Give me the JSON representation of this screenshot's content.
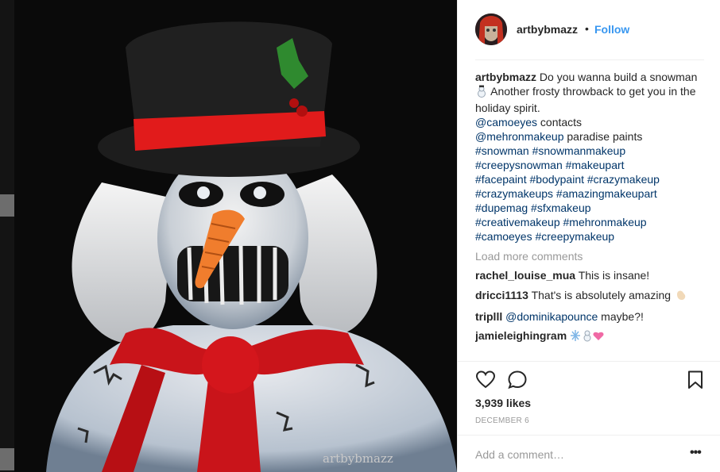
{
  "post": {
    "watermark": "artbybmazz"
  },
  "header": {
    "username": "artbybmazz",
    "separator": "•",
    "follow_label": "Follow"
  },
  "caption": {
    "username": "artbybmazz",
    "text": "Do you wanna build a snowman",
    "text2": "Another frosty throwback to get you in the holiday spirit.",
    "credits": [
      {
        "mention": "@camoeyes",
        "text": " contacts"
      },
      {
        "mention": "@mehronmakeup",
        "text": " paradise paints"
      }
    ],
    "hashtag_lines": [
      "#snowman #snowmanmakeup",
      "#creepysnowman #makeupart",
      "#facepaint #bodypaint #crazymakeup",
      "#crazymakeups #amazingmakeupart",
      "#dupemag #sfxmakeup",
      "#creativemakeup #mehronmakeup",
      "#camoeyes #creepymakeup"
    ]
  },
  "load_more_label": "Load more comments",
  "comments": [
    {
      "username": "rachel_louise_mua",
      "text": "This is insane!"
    },
    {
      "username": "dricci1113",
      "text": "That's is absolutely amazing"
    },
    {
      "username": "triplll",
      "mention": "@dominikapounce",
      "text": " maybe?!"
    },
    {
      "username": "jamieleighingram",
      "text": ""
    }
  ],
  "actions": {
    "like_icon": "heart-icon",
    "comment_icon": "comment-bubble-icon",
    "save_icon": "bookmark-icon"
  },
  "likes": "3,939 likes",
  "date": "DECEMBER 6",
  "add_comment": {
    "placeholder": "Add a comment…",
    "more_label": "•••"
  },
  "colors": {
    "link": "#003569",
    "follow": "#3897f0",
    "muted": "#999999",
    "text": "#262626"
  }
}
